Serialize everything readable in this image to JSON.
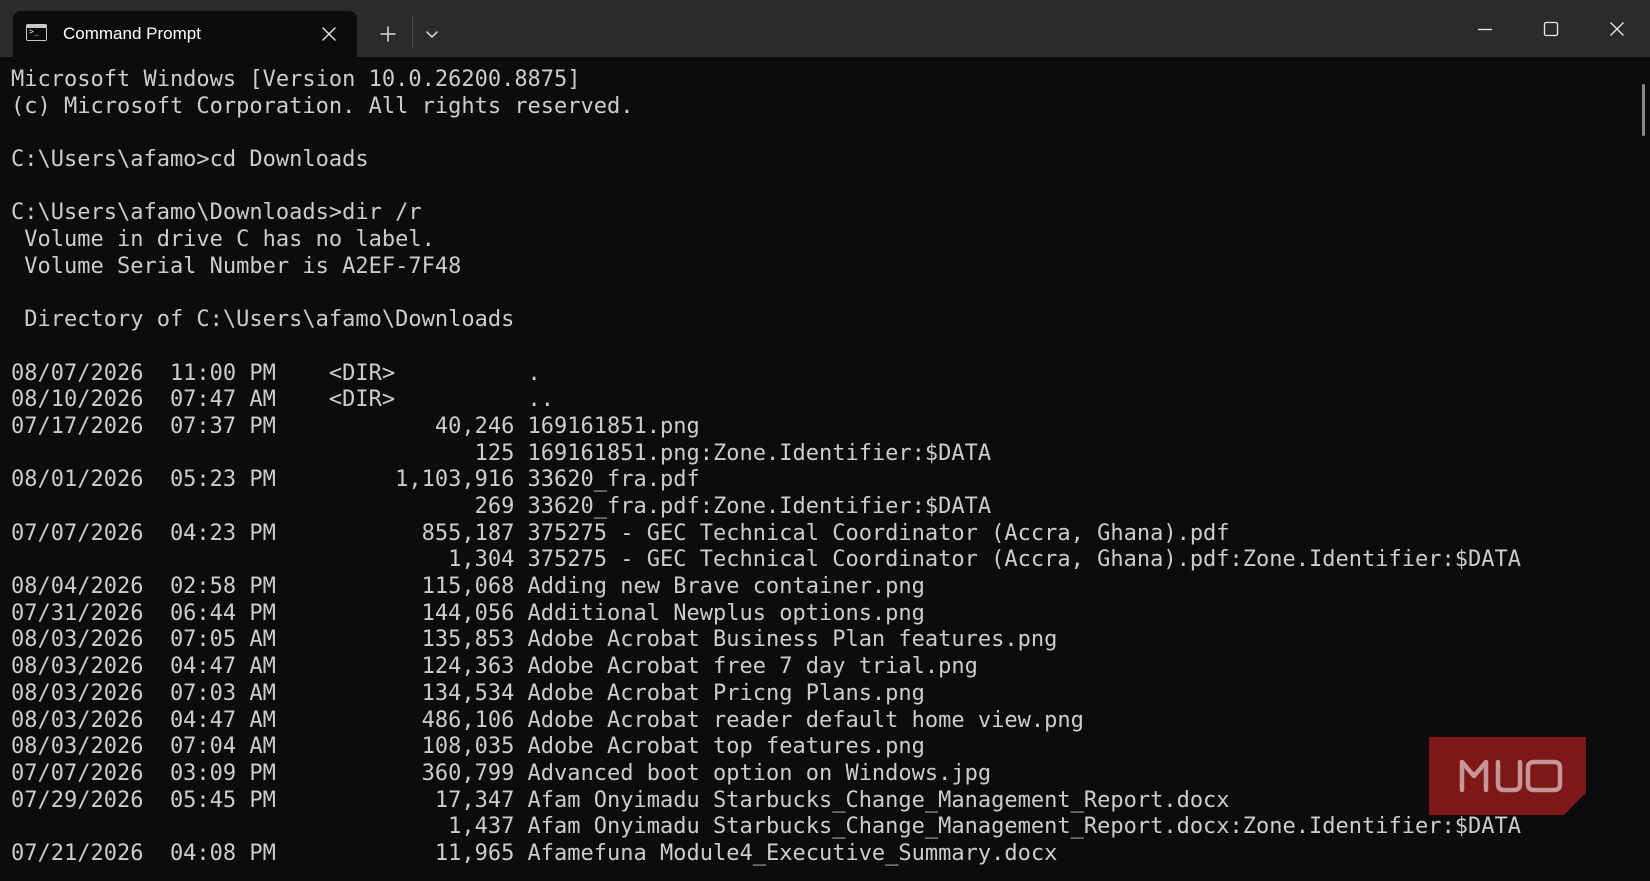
{
  "window": {
    "tab": {
      "title": "Command Prompt",
      "icon": "terminal-icon"
    },
    "controls": {
      "tab_close_icon": "close-icon",
      "new_tab_icon": "plus-icon",
      "dropdown_icon": "chevron-down-icon",
      "minimize_icon": "minimize-icon",
      "maximize_icon": "maximize-icon",
      "close_icon": "close-icon"
    }
  },
  "terminal": {
    "colors": {
      "background": "#0c0c0c",
      "foreground": "#cccccc",
      "titlebar": "#2b2b2b"
    },
    "lines": [
      "Microsoft Windows [Version 10.0.26200.8875]",
      "(c) Microsoft Corporation. All rights reserved.",
      "",
      "C:\\Users\\afamo>cd Downloads",
      "",
      "C:\\Users\\afamo\\Downloads>dir /r",
      " Volume in drive C has no label.",
      " Volume Serial Number is A2EF-7F48",
      "",
      " Directory of C:\\Users\\afamo\\Downloads",
      "",
      "08/07/2026  11:00 PM    <DIR>          .",
      "08/10/2026  07:47 AM    <DIR>          ..",
      "07/17/2026  07:37 PM            40,246 169161851.png",
      "                                   125 169161851.png:Zone.Identifier:$DATA",
      "08/01/2026  05:23 PM         1,103,916 33620_fra.pdf",
      "                                   269 33620_fra.pdf:Zone.Identifier:$DATA",
      "07/07/2026  04:23 PM           855,187 375275 - GEC Technical Coordinator (Accra, Ghana).pdf",
      "                                 1,304 375275 - GEC Technical Coordinator (Accra, Ghana).pdf:Zone.Identifier:$DATA",
      "08/04/2026  02:58 PM           115,068 Adding new Brave container.png",
      "07/31/2026  06:44 PM           144,056 Additional Newplus options.png",
      "08/03/2026  07:05 AM           135,853 Adobe Acrobat Business Plan features.png",
      "08/03/2026  04:47 AM           124,363 Adobe Acrobat free 7 day trial.png",
      "08/03/2026  07:03 AM           134,534 Adobe Acrobat Pricng Plans.png",
      "08/03/2026  04:47 AM           486,106 Adobe Acrobat reader default home view.png",
      "08/03/2026  07:04 AM           108,035 Adobe Acrobat top features.png",
      "07/07/2026  03:09 PM           360,799 Advanced boot option on Windows.jpg",
      "07/29/2026  05:45 PM            17,347 Afam Onyimadu Starbucks_Change_Management_Report.docx",
      "                                 1,437 Afam Onyimadu Starbucks_Change_Management_Report.docx:Zone.Identifier:$DATA",
      "07/21/2026  04:08 PM            11,965 Afamefuna Module4_Executive_Summary.docx"
    ]
  },
  "watermark": {
    "text": "MUO",
    "color": "#8b1a1a"
  }
}
